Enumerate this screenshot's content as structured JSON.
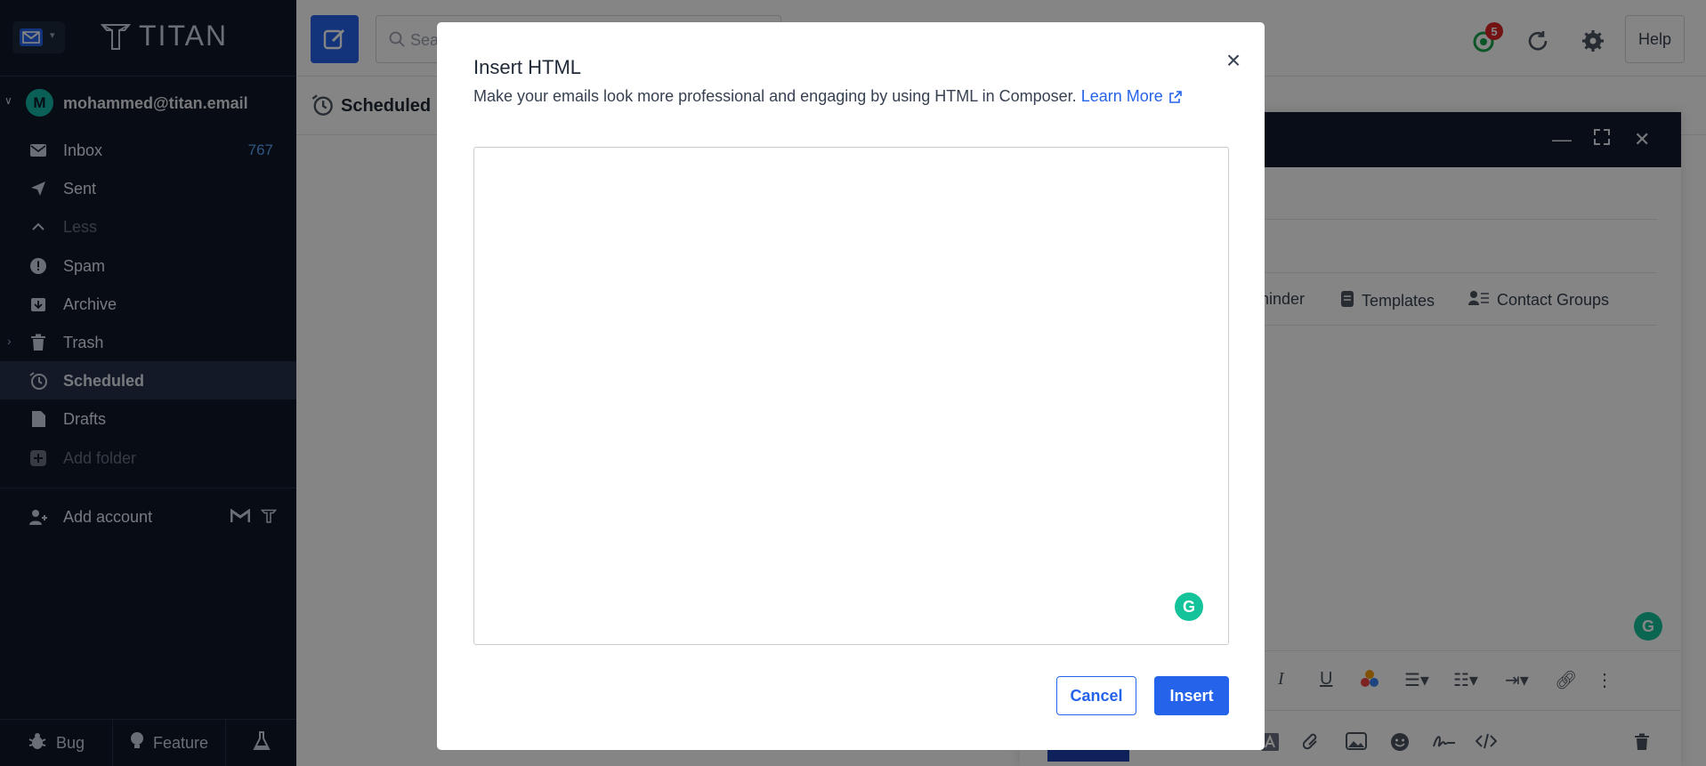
{
  "brand": {
    "name": "TITAN"
  },
  "account": {
    "initial": "M",
    "email": "mohammed@titan.email"
  },
  "folders": [
    {
      "label": "Inbox",
      "count": "767"
    },
    {
      "label": "Sent"
    },
    {
      "label": "Less"
    },
    {
      "label": "Spam"
    },
    {
      "label": "Archive"
    },
    {
      "label": "Trash"
    },
    {
      "label": "Scheduled"
    },
    {
      "label": "Drafts"
    },
    {
      "label": "Add folder"
    }
  ],
  "add_account": {
    "label": "Add account"
  },
  "bottom": {
    "bug": "Bug",
    "feature": "Feature"
  },
  "search": {
    "placeholder": "Sea"
  },
  "header": {
    "badge": "5",
    "help": "Help"
  },
  "subheader": {
    "title": "Scheduled"
  },
  "composer": {
    "reminder": "ninder",
    "templates": "Templates",
    "contact_groups": "Contact Groups"
  },
  "modal": {
    "title": "Insert HTML",
    "description": "Make your emails look more professional and engaging by using HTML in Composer.",
    "learn_more": "Learn More",
    "html_value": "",
    "cancel": "Cancel",
    "insert": "Insert"
  },
  "colors": {
    "sidebar_bg": "#0f1729",
    "accent": "#2563eb",
    "count": "#60a5fa",
    "grammarly": "#15c39a"
  }
}
